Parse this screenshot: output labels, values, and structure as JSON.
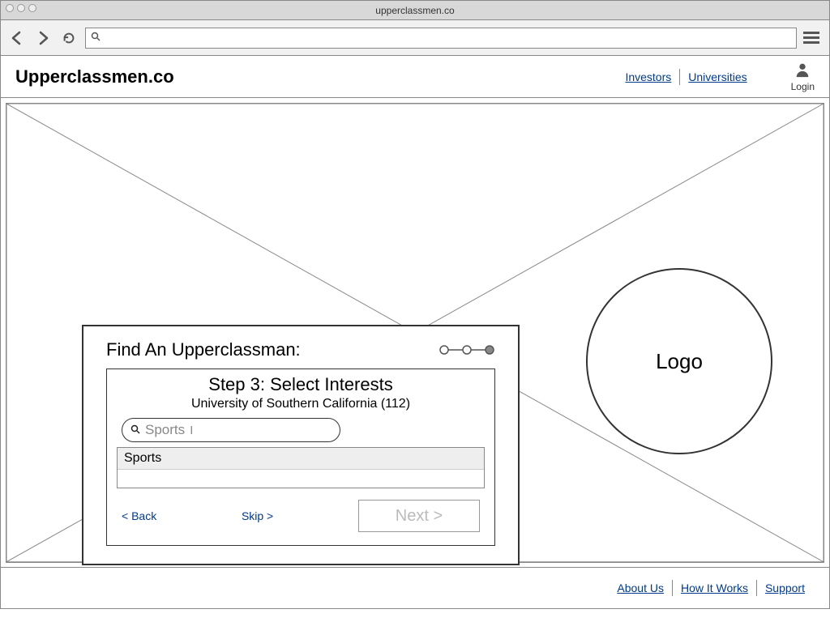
{
  "browser": {
    "title": "upperclassmen.co",
    "url_value": ""
  },
  "header": {
    "brand": "Upperclassmen.co",
    "links": {
      "investors": "Investors",
      "universities": "Universities"
    },
    "login_label": "Login"
  },
  "hero": {
    "logo_label": "Logo"
  },
  "panel": {
    "title": "Find An Upperclassman:",
    "step_current": 3,
    "step_total": 3,
    "step_head": "Step 3:  Select Interests",
    "step_sub": "University of Southern California (112)",
    "search_value": "Sports",
    "suggestion": "Sports",
    "back_label": "< Back",
    "skip_label": "Skip >",
    "next_label": "Next >"
  },
  "footer": {
    "about": "About Us",
    "how": "How It Works",
    "support": "Support"
  }
}
